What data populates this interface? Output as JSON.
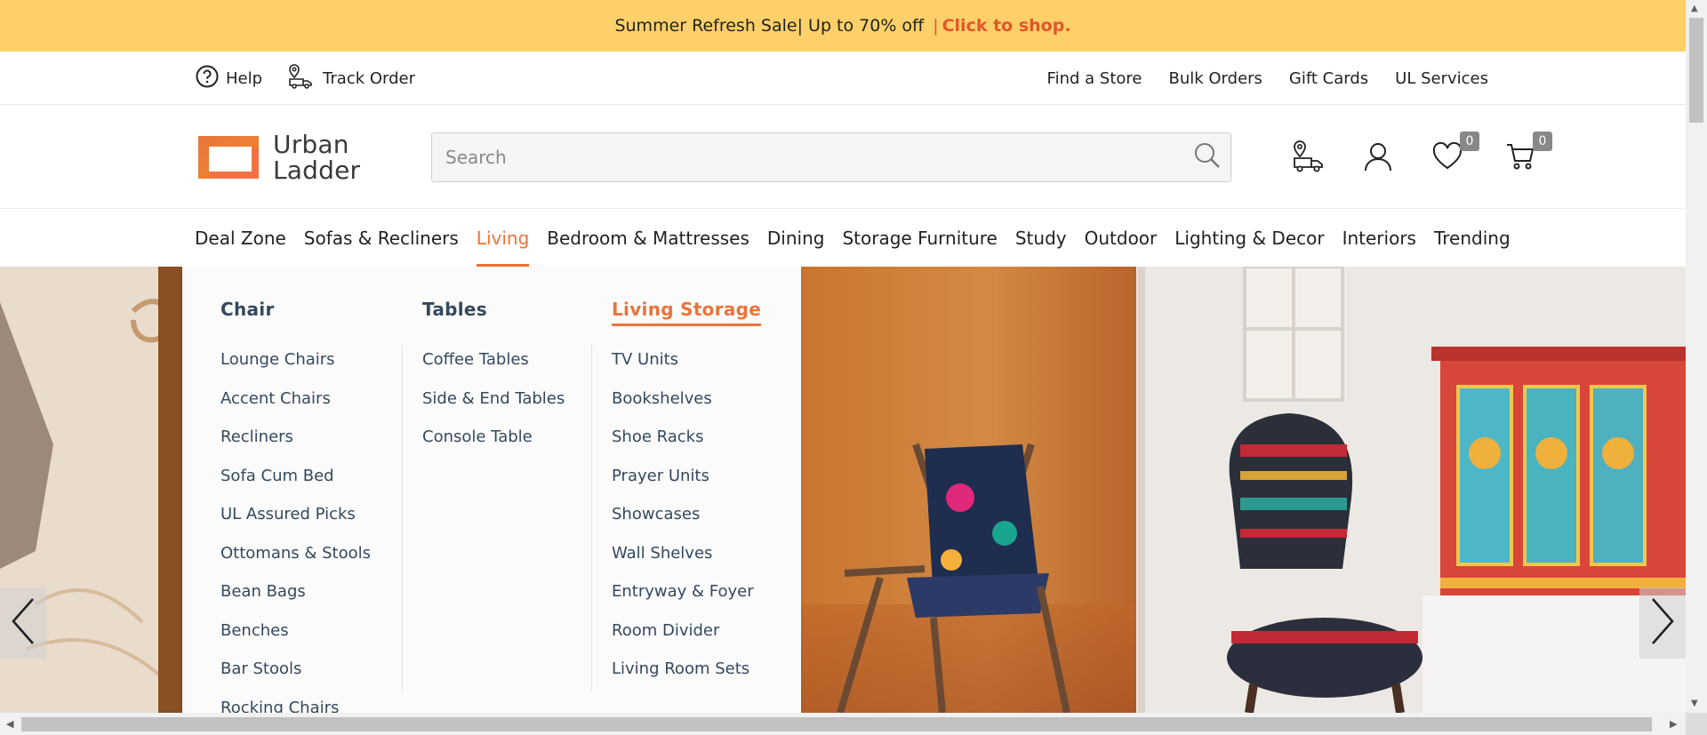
{
  "promo": {
    "text": "Summer Refresh Sale",
    "offer": "Up to 70% off",
    "cta": "Click to shop."
  },
  "utility": {
    "help": "Help",
    "track_order": "Track Order",
    "right_links": [
      "Find a Store",
      "Bulk Orders",
      "Gift Cards",
      "UL Services"
    ]
  },
  "logo": {
    "line1": "Urban",
    "line2": "Ladder"
  },
  "search": {
    "placeholder": "Search",
    "value": ""
  },
  "header_icons": {
    "wishlist_count": "0",
    "cart_count": "0"
  },
  "nav": {
    "items": [
      "Deal Zone",
      "Sofas & Recliners",
      "Living",
      "Bedroom & Mattresses",
      "Dining",
      "Storage Furniture",
      "Study",
      "Outdoor",
      "Lighting & Decor",
      "Interiors",
      "Trending"
    ],
    "active": "Living"
  },
  "mega_menu": {
    "columns": [
      {
        "title": "Chair",
        "items": [
          "Lounge Chairs",
          "Accent Chairs",
          "Recliners",
          "Sofa Cum Bed",
          "UL Assured Picks",
          "Ottomans & Stools",
          "Bean Bags",
          "Benches",
          "Bar Stools",
          "Rocking Chairs"
        ]
      },
      {
        "title": "Tables",
        "items": [
          "Coffee Tables",
          "Side & End Tables",
          "Console Table"
        ]
      },
      {
        "title": "Living Storage",
        "items": [
          "TV Units",
          "Bookshelves",
          "Shoe Racks",
          "Prayer Units",
          "Showcases",
          "Wall Shelves",
          "Entryway & Foyer",
          "Room Divider",
          "Living Room Sets"
        ]
      }
    ],
    "active_column": "Living Storage"
  },
  "colors": {
    "promo_bg": "#fdd069",
    "accent": "#e8743b",
    "menu_text": "#34495e"
  }
}
